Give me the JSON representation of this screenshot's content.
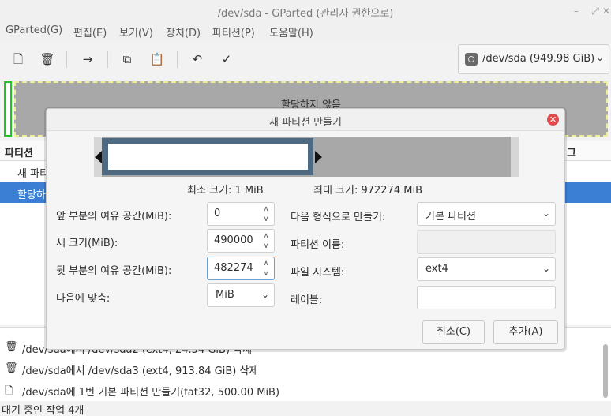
{
  "window": {
    "title": "/dev/sda - GParted (관리자 권한으로)"
  },
  "menu": [
    "GParted(G)",
    "편집(E)",
    "보기(V)",
    "장치(D)",
    "파티션(P)",
    "도움말(H)"
  ],
  "device": {
    "label": "/dev/sda  (949.98 GiB)"
  },
  "graph": {
    "unallocated_label": "할당하지 않음"
  },
  "partitions": {
    "header_partition": "파티션",
    "header_flags": "그",
    "rows": [
      "새 파티",
      "할당하"
    ]
  },
  "dialog": {
    "title": "새 파티션 만들기",
    "min_size": "최소 크기: 1 MiB",
    "max_size": "최대 크기: 972274 MiB",
    "free_before_label": "앞 부분의 여유 공간(MiB):",
    "free_before_value": "0",
    "new_size_label": "새 크기(MiB):",
    "new_size_value": "490000",
    "free_after_label": "뒷 부분의 여유 공간(MiB):",
    "free_after_value": "482274",
    "align_label": "다음에 맞춤:",
    "align_value": "MiB",
    "create_as_label": "다음 형식으로 만들기:",
    "create_as_value": "기본 파티션",
    "name_label": "파티션 이름:",
    "fs_label": "파일 시스템:",
    "fs_value": "ext4",
    "label_label": "레이블:",
    "cancel": "취소(C)",
    "add": "추가(A)"
  },
  "operations": [
    "/dev/sda에서 /dev/sda2 (ext4, 24.54 GiB) 삭제",
    "/dev/sda에서 /dev/sda3 (ext4, 913.84 GiB) 삭제",
    "/dev/sda에 1번 기본 파티션 만들기(fat32, 500.00 MiB)"
  ],
  "status": "대기 중인 작업 4개"
}
